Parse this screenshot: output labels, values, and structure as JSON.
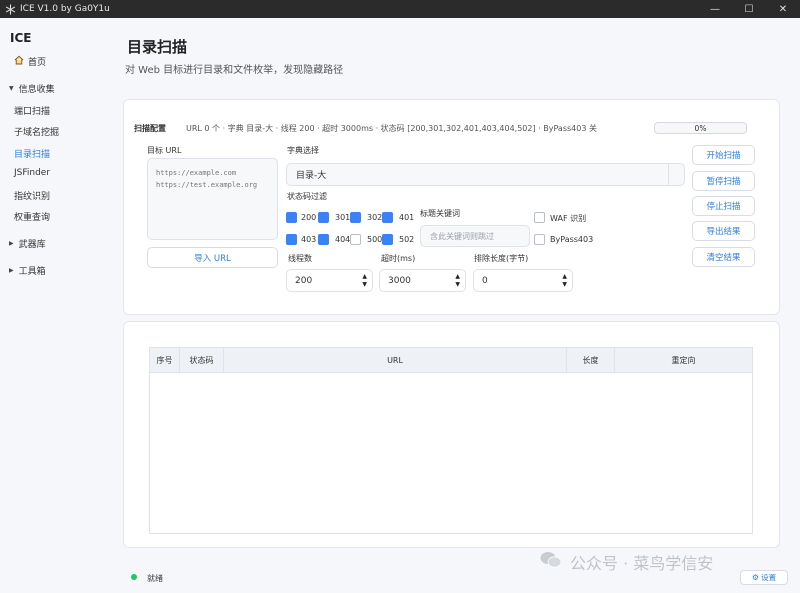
{
  "window": {
    "title": "ICE V1.0 by Ga0Y1u",
    "controls": {
      "minimize": "—",
      "maximize": "☐",
      "close": "✕"
    }
  },
  "sidebar": {
    "brand": "ICE",
    "home": "首页",
    "group_info": "信息收集",
    "items": [
      "端口扫描",
      "子域名挖掘",
      "目录扫描",
      "JSFinder",
      "指纹识别",
      "权重查询"
    ],
    "active": "目录扫描",
    "group_arsenal": "武器库",
    "group_toolbox": "工具箱"
  },
  "page": {
    "title": "目录扫描",
    "subtitle": "对 Web 目标进行目录和文件枚举，发现隐藏路径"
  },
  "config": {
    "label": "扫描配置",
    "summary": "URL 0 个 · 字典 目录-大 · 线程 200 · 超时 3000ms · 状态码 [200,301,302,401,403,404,502] · ByPass403 关",
    "progress": "0%",
    "target_label": "目标 URL",
    "target_placeholder": "https://example.com\nhttps://test.example.org",
    "import_button": "导入 URL",
    "dict_label": "字典选择",
    "dict_value": "目录-大",
    "status_filter_label": "状态码过滤",
    "status_codes": [
      {
        "code": "200",
        "checked": true
      },
      {
        "code": "301",
        "checked": true
      },
      {
        "code": "302",
        "checked": true
      },
      {
        "code": "401",
        "checked": true
      },
      {
        "code": "403",
        "checked": true
      },
      {
        "code": "404",
        "checked": true
      },
      {
        "code": "500",
        "checked": false
      },
      {
        "code": "502",
        "checked": true
      }
    ],
    "keyword_label": "标题关键词",
    "keyword_placeholder": "含此关键词则跳过",
    "waf_label": "WAF 识别",
    "bypass_label": "ByPass403",
    "threads_label": "线程数",
    "threads_value": "200",
    "timeout_label": "超时(ms)",
    "timeout_value": "3000",
    "exclude_label": "排除长度(字节)",
    "exclude_value": "0",
    "buttons": {
      "start": "开始扫描",
      "pause": "暂停扫描",
      "stop": "停止扫描",
      "export": "导出结果",
      "clear": "清空结果"
    }
  },
  "results": {
    "columns": [
      "序号",
      "状态码",
      "URL",
      "长度",
      "重定向"
    ]
  },
  "status": {
    "text": "就绪",
    "color": "#22c55e"
  },
  "settings_button": "设置",
  "watermark": "公众号 · 菜鸟学信安",
  "colors": {
    "accent": "#2f7de1",
    "checkbox": "#3b82f6"
  }
}
